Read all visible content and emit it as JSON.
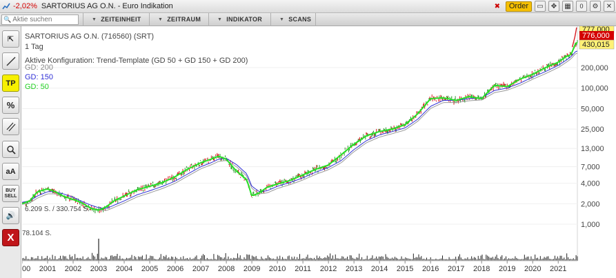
{
  "titlebar": {
    "change": "-2,02%",
    "title": "SARTORIUS AG O.N. - Euro Indikation",
    "order_label": "Order",
    "badge_count": "0"
  },
  "toolbar": {
    "search_placeholder": "Aktie suchen",
    "menus": [
      "ZEITEINHEIT",
      "ZEITRAUM",
      "INDIKATOR",
      "SCANS"
    ]
  },
  "sidebar": {
    "tp_label": "TP",
    "aa_label": "aA",
    "buy_label": "BUY",
    "sell_label": "SELL",
    "close_label": "X"
  },
  "chart_info": {
    "title": "SARTORIUS AG O.N. (716560) (SRT)",
    "interval": "1 Tag",
    "config": "Aktive Konfiguration: Trend-Template (GD 50 + GD 150 + GD 200)",
    "ma200_label": "GD: 200",
    "ma150_label": "GD: 150",
    "ma50_label": "GD: 50",
    "vol_label_1": "6.209 S. / 330.754 S.",
    "vol_label_2": "78.104 S."
  },
  "price_tags": {
    "top": "777,000",
    "last": "776,000",
    "ma": "430,015"
  },
  "colors": {
    "price": "#d71920",
    "ma50": "#25e025",
    "ma150": "#2f2fd6",
    "ma200": "#999999",
    "last_tag": "#d40000",
    "tag_bg": "#fff176"
  },
  "chart_data": {
    "type": "line",
    "scale": "log",
    "ylim": [
      780,
      780
    ],
    "y_ticks": [
      "1,000",
      "2,000",
      "4,000",
      "7,000",
      "13,000",
      "25,000",
      "50,000",
      "100,000",
      "200,000"
    ],
    "y_tick_values": [
      1,
      2,
      4,
      7,
      13,
      25,
      50,
      100,
      200
    ],
    "x_ticks": [
      "2000",
      "2001",
      "2002",
      "2003",
      "2004",
      "2005",
      "2006",
      "2007",
      "2008",
      "2009",
      "2010",
      "2011",
      "2012",
      "2013",
      "2014",
      "2015",
      "2016",
      "2017",
      "2018",
      "2019",
      "2020",
      "2021"
    ],
    "x": [
      2000.0,
      2000.3,
      2000.6,
      2001.0,
      2001.3,
      2001.6,
      2002.0,
      2002.3,
      2002.7,
      2003.0,
      2003.3,
      2003.6,
      2004.0,
      2004.5,
      2005.0,
      2005.5,
      2006.0,
      2006.5,
      2007.0,
      2007.4,
      2007.7,
      2008.0,
      2008.4,
      2008.8,
      2009.0,
      2009.3,
      2009.6,
      2010.0,
      2010.5,
      2011.0,
      2011.5,
      2012.0,
      2012.5,
      2013.0,
      2013.5,
      2014.0,
      2014.5,
      2015.0,
      2015.5,
      2016.0,
      2016.5,
      2017.0,
      2017.5,
      2018.0,
      2018.5,
      2019.0,
      2019.5,
      2020.0,
      2020.5,
      2021.0,
      2021.3,
      2021.5,
      2021.7
    ],
    "series": [
      {
        "name": "GD: 50",
        "values": [
          2.0,
          2.2,
          3.0,
          3.3,
          3.0,
          2.6,
          2.3,
          2.1,
          1.7,
          1.6,
          1.8,
          2.2,
          2.6,
          3.2,
          3.6,
          4.1,
          5.0,
          6.5,
          8.0,
          9.0,
          10.0,
          9.0,
          6.0,
          4.5,
          2.6,
          2.9,
          3.5,
          3.9,
          4.4,
          5.3,
          6.4,
          7.4,
          10.5,
          15.0,
          20.0,
          23.0,
          25.0,
          29.0,
          42.0,
          70.0,
          72.0,
          66.0,
          75.0,
          70.0,
          110.0,
          105.0,
          135.0,
          160.0,
          200.0,
          240.0,
          290.0,
          310.0,
          470.0
        ]
      },
      {
        "name": "GD: 150",
        "values": [
          2.1,
          2.2,
          2.6,
          3.0,
          3.0,
          2.8,
          2.5,
          2.2,
          1.9,
          1.75,
          1.7,
          1.9,
          2.2,
          2.7,
          3.1,
          3.6,
          4.3,
          5.5,
          7.0,
          8.0,
          9.0,
          9.3,
          7.5,
          5.5,
          3.6,
          3.0,
          3.1,
          3.6,
          4.1,
          4.8,
          5.8,
          6.8,
          8.6,
          12.5,
          17.0,
          20.5,
          23.0,
          26.0,
          35.0,
          54.0,
          66.0,
          66.0,
          70.0,
          72.0,
          92.0,
          100.0,
          118.0,
          145.0,
          175.0,
          215.0,
          255.0,
          290.0,
          350.0
        ]
      }
    ]
  }
}
